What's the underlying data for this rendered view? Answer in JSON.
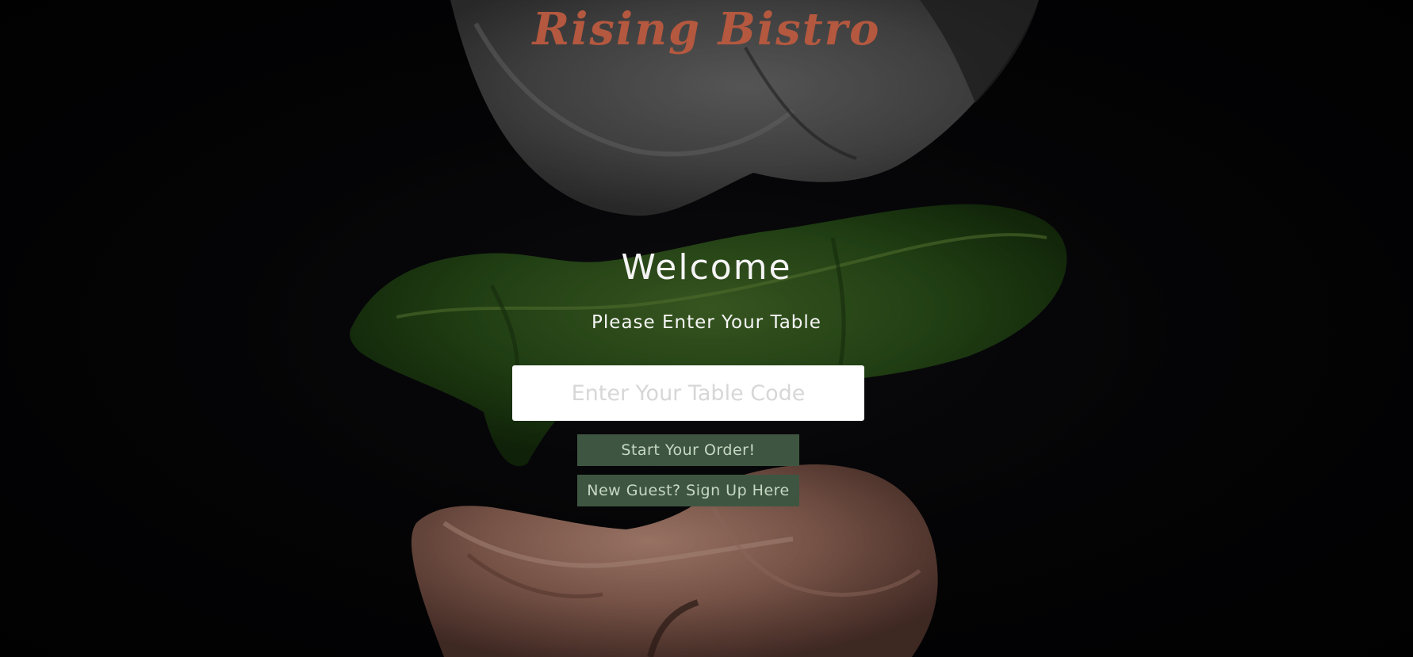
{
  "brand": {
    "name": "Rising Bistro"
  },
  "hero": {
    "title": "Welcome",
    "subtitle": "Please Enter Your Table"
  },
  "form": {
    "table_code": {
      "value": "",
      "placeholder": "Enter Your Table Code"
    },
    "start_label": "Start Your Order!",
    "signup_label": "New Guest? Sign Up Here"
  },
  "colors": {
    "brand_text": "#b4583f",
    "button_bg": "#3e5641",
    "button_text": "#c7d8c4",
    "background": "#050507"
  }
}
